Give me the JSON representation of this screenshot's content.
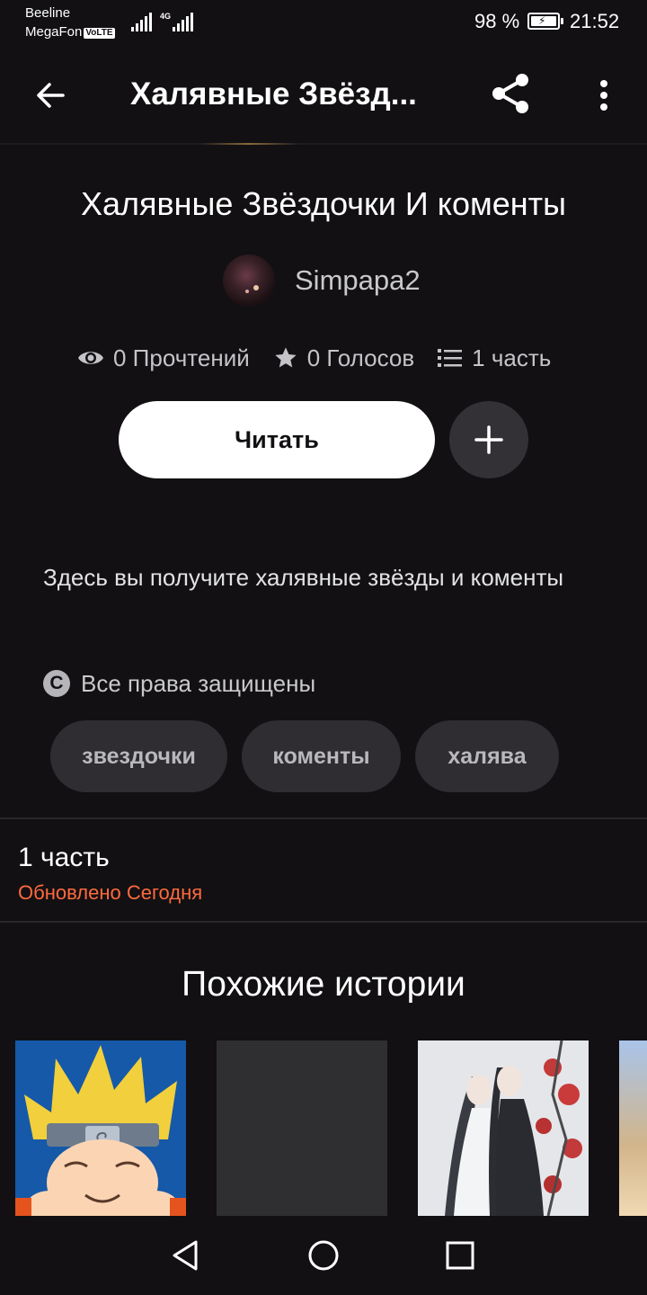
{
  "status_bar": {
    "carrier_1": "Beeline",
    "carrier_2": "MegaFon",
    "volte": "VoLTE",
    "network": "4G",
    "battery": "98 %",
    "time": "21:52"
  },
  "app_bar": {
    "title": "Халявные Звёзд...",
    "back_icon": "arrow-left-icon",
    "share_icon": "share-icon",
    "more_icon": "more-vertical-icon"
  },
  "story": {
    "title": "Халявные Звёздочки И коменты",
    "author": "Simpapa2",
    "stats": {
      "reads": "0 Прочтений",
      "votes": "0 Голосов",
      "parts": "1 часть"
    },
    "read_button": "Читать",
    "description": "Здесь вы получите халявные звёзды и коменты",
    "copyright": "Все права защищены",
    "tags": [
      "звездочки",
      "коменты",
      "халява"
    ]
  },
  "parts": {
    "title": "1 часть",
    "updated": "Обновлено Сегодня"
  },
  "similar": {
    "title": "Похожие истории"
  },
  "colors": {
    "background": "#121013",
    "accent_orange": "#ff6a3d",
    "tag_bg": "#2f2d31",
    "button_bg": "#ffffff"
  }
}
